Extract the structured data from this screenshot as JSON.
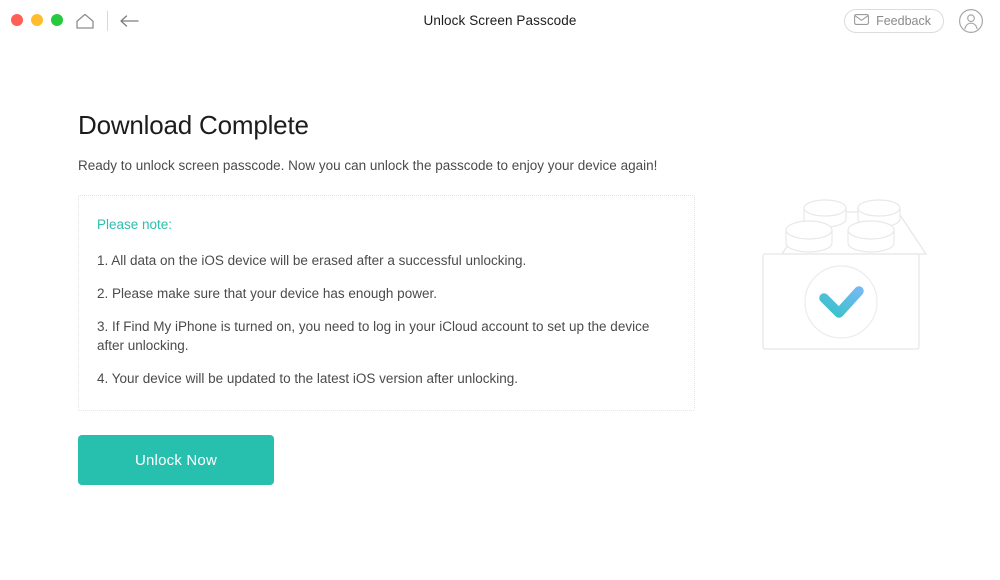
{
  "window": {
    "title": "Unlock Screen Passcode",
    "traffic_lights": [
      {
        "name": "close",
        "color": "#ff5f56"
      },
      {
        "name": "minimize",
        "color": "#ffbd2e"
      },
      {
        "name": "zoom",
        "color": "#27c93f"
      }
    ],
    "home_icon": "home-icon",
    "back_icon": "back-arrow-icon",
    "feedback_label": "Feedback",
    "feedback_icon": "envelope-icon",
    "account_icon": "user-avatar-icon"
  },
  "main": {
    "title": "Download Complete",
    "subtitle": "Ready to unlock screen passcode. Now you can unlock the passcode to enjoy your device again!",
    "notes": {
      "heading": "Please note:",
      "items": [
        "1. All data on the iOS device will be erased after a successful unlocking.",
        "2. Please make sure that your device has enough power.",
        "3. If Find My iPhone is turned on, you need to log in your iCloud account to set up the device after unlocking.",
        "4. Your device will be updated to the latest iOS version after unlocking."
      ]
    },
    "primary_button": "Unlock Now",
    "illustration": {
      "name": "lego-box-with-checkmark-illustration",
      "check_icon": "checkmark-icon"
    }
  },
  "colors": {
    "accent": "#27bfad",
    "note_heading": "#2bbfad",
    "check_gradient_start": "#3fc3cf",
    "check_gradient_end": "#6ab9ef",
    "text_primary": "#1c1c1c",
    "text_secondary": "#4b4b4b",
    "border_light": "#e2e2e2"
  }
}
